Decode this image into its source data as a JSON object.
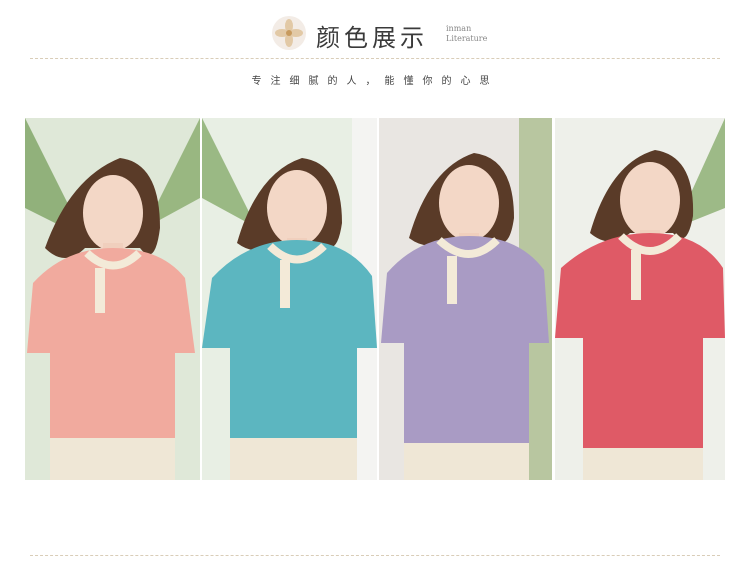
{
  "header": {
    "title": "颜色展示",
    "brand_line1": "inman",
    "brand_line2": "Literature"
  },
  "subtitle": "专注细腻的人，能懂你的心思",
  "photos": [
    {
      "color_name": "pink",
      "shirt_color": "#f1aa9e",
      "bg": "#dfe8d8"
    },
    {
      "color_name": "teal",
      "shirt_color": "#5cb6c0",
      "bg": "#e8efe4"
    },
    {
      "color_name": "lavender",
      "shirt_color": "#a99bc4",
      "bg": "#e9e6e2"
    },
    {
      "color_name": "coral-red",
      "shirt_color": "#df5a66",
      "bg": "#eef0ea"
    }
  ],
  "icons": {
    "logo": "flower-logo-icon"
  }
}
